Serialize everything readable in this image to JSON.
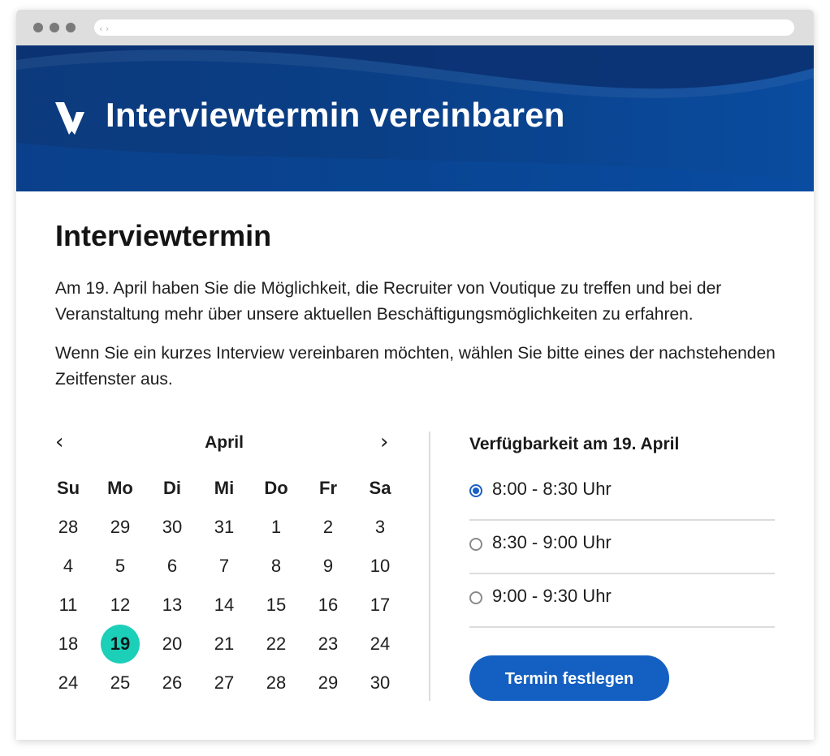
{
  "browser": {
    "nav_arrows": "‹ ›"
  },
  "banner": {
    "title": "Interviewtermin vereinbaren",
    "logo_icon": "voutique-v-logo"
  },
  "content": {
    "section_title": "Interviewtermin",
    "paragraph_1": "Am 19. April haben Sie die Möglichkeit, die Recruiter von Voutique zu treffen und bei der Veranstaltung mehr über unsere aktuellen Beschäftigungsmöglichkeiten zu erfahren.",
    "paragraph_2": "Wenn Sie ein kurzes Interview vereinbaren möchten, wählen Sie bitte eines der nachstehenden Zeitfenster aus."
  },
  "calendar": {
    "prev_icon": "chevron-left-icon",
    "next_icon": "chevron-right-icon",
    "prev_glyph": "‹",
    "next_glyph": "›",
    "month": "April",
    "weekdays": [
      "Su",
      "Mo",
      "Di",
      "Mi",
      "Do",
      "Fr",
      "Sa"
    ],
    "weeks": [
      [
        "28",
        "29",
        "30",
        "31",
        "1",
        "2",
        "3"
      ],
      [
        "4",
        "5",
        "6",
        "7",
        "8",
        "9",
        "10"
      ],
      [
        "11",
        "12",
        "13",
        "14",
        "15",
        "16",
        "17"
      ],
      [
        "18",
        "19",
        "20",
        "21",
        "22",
        "23",
        "24"
      ],
      [
        "24",
        "25",
        "26",
        "27",
        "28",
        "29",
        "30"
      ]
    ],
    "selected_day": "19",
    "selected_color": "#1ccfb8"
  },
  "availability": {
    "title": "Verfügbarkeit am 19. April",
    "slots": [
      {
        "label": "8:00 - 8:30 Uhr",
        "checked": true
      },
      {
        "label": "8:30 - 9:00 Uhr",
        "checked": false
      },
      {
        "label": "9:00 - 9:30 Uhr",
        "checked": false
      }
    ],
    "button_label": "Termin festlegen",
    "accent_color": "#1460c2"
  }
}
